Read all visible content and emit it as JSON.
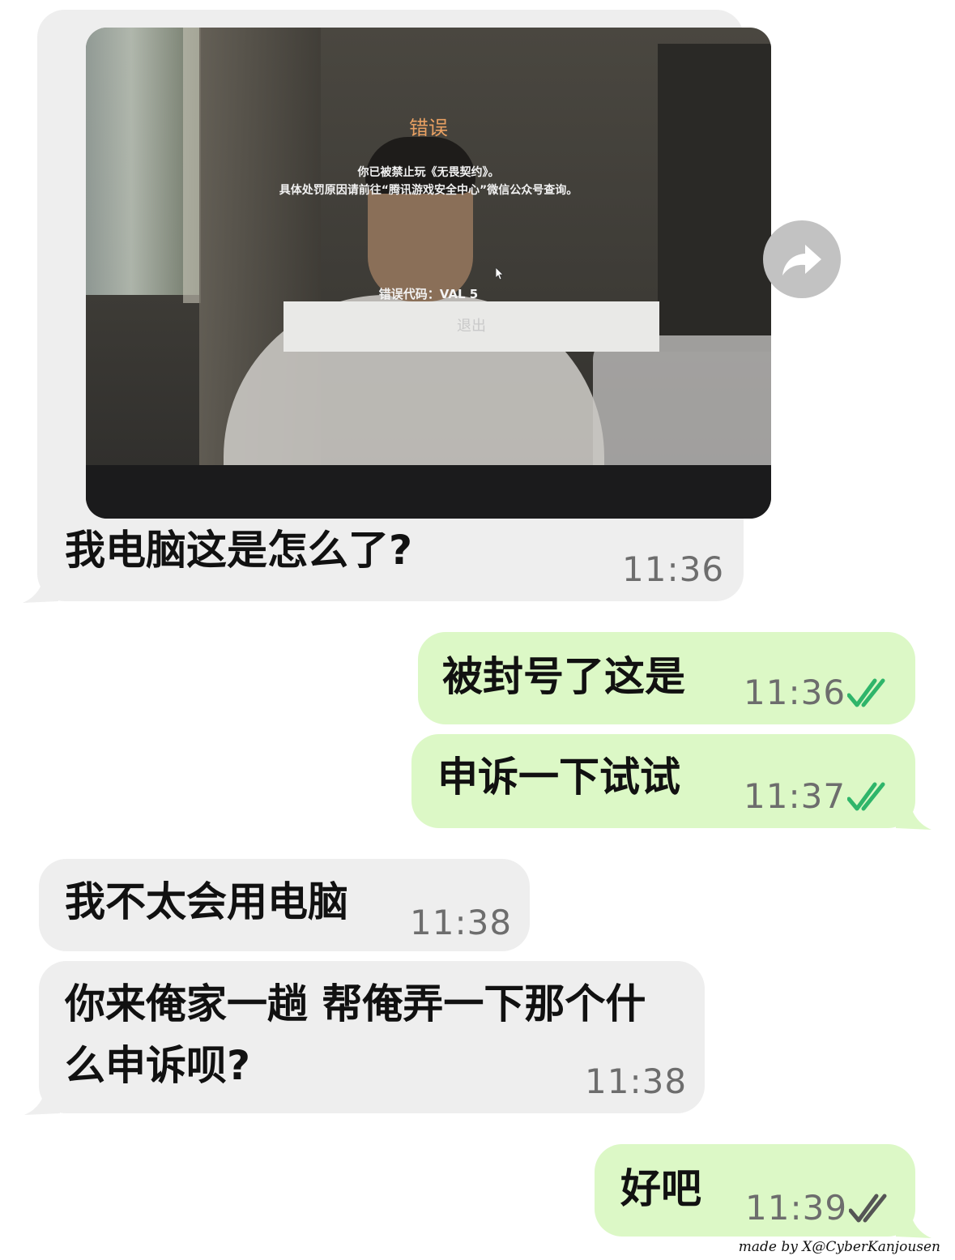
{
  "messages": [
    {
      "direction": "incoming",
      "text": "我电脑这是怎么了?",
      "time": "11:36",
      "photo": {
        "error_title": "错误",
        "error_line1": "你已被禁止玩《无畏契约》。",
        "error_line2": "具体处罚原因请前往“腾讯游戏安全中心”微信公众号查询。",
        "error_code": "错误代码：VAL 5",
        "exit_label": "退出"
      }
    },
    {
      "direction": "outgoing",
      "text": "被封号了这是",
      "time": "11:36",
      "status": "read"
    },
    {
      "direction": "outgoing",
      "text": "申诉一下试试",
      "time": "11:37",
      "status": "read"
    },
    {
      "direction": "incoming",
      "text": "我不太会用电脑",
      "time": "11:38"
    },
    {
      "direction": "incoming",
      "text_line1": "你来俺家一趟 帮俺弄一下那个什",
      "text_line2": "么申诉呗?",
      "time": "11:38"
    },
    {
      "direction": "outgoing",
      "text": "好吧",
      "time": "11:39",
      "status": "read"
    }
  ],
  "forward_icon": "forward-arrow-icon",
  "watermark": "made by X@CyberKanjousen",
  "colors": {
    "incoming_bubble": "#eeeeee",
    "outgoing_bubble": "#dcf8c6",
    "read_tick": "#2fb56a",
    "sent_tick": "#555555",
    "error_title": "#e9a062"
  }
}
